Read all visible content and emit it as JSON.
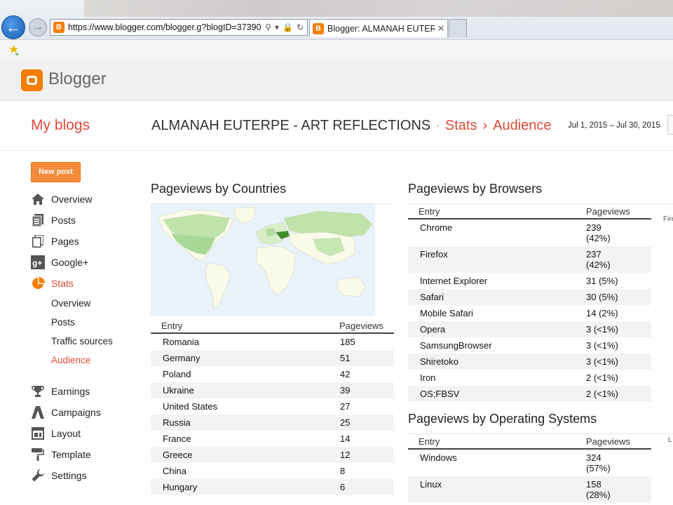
{
  "browser": {
    "url": "https://www.blogger.com/blogger.g?blogID=37390",
    "tab_title": "Blogger: ALMANAH EUTER...",
    "favicon": "B"
  },
  "header": {
    "brand": "Blogger",
    "brand_color": "#f57d00"
  },
  "topbar": {
    "my_blogs": "My blogs",
    "blog_name": "ALMANAH EUTERPE - ART REFLECTIONS",
    "sep": "·",
    "crumb_stats": "Stats",
    "crumb_arrow": "›",
    "crumb_audience": "Audience",
    "date_range": "Jul 1, 2015 – Jul 30, 2015"
  },
  "sidebar": {
    "new_post": "New post",
    "items": [
      {
        "label": "Overview"
      },
      {
        "label": "Posts"
      },
      {
        "label": "Pages"
      },
      {
        "label": "Google+"
      },
      {
        "label": "Stats"
      }
    ],
    "stats_sub": [
      {
        "label": "Overview"
      },
      {
        "label": "Posts"
      },
      {
        "label": "Traffic sources"
      },
      {
        "label": "Audience"
      }
    ],
    "items2": [
      {
        "label": "Earnings"
      },
      {
        "label": "Campaigns"
      },
      {
        "label": "Layout"
      },
      {
        "label": "Template"
      },
      {
        "label": "Settings"
      }
    ]
  },
  "countries": {
    "title": "Pageviews by Countries",
    "col_entry": "Entry",
    "col_pageviews": "Pageviews",
    "rows": [
      {
        "entry": "Romania",
        "pv": "185"
      },
      {
        "entry": "Germany",
        "pv": "51"
      },
      {
        "entry": "Poland",
        "pv": "42"
      },
      {
        "entry": "Ukraine",
        "pv": "39"
      },
      {
        "entry": "United States",
        "pv": "27"
      },
      {
        "entry": "Russia",
        "pv": "25"
      },
      {
        "entry": "France",
        "pv": "14"
      },
      {
        "entry": "Greece",
        "pv": "12"
      },
      {
        "entry": "China",
        "pv": "8"
      },
      {
        "entry": "Hungary",
        "pv": "6"
      }
    ]
  },
  "browsers": {
    "title": "Pageviews by Browsers",
    "col_entry": "Entry",
    "col_pageviews": "Pageviews",
    "side_label": "Fire",
    "rows": [
      {
        "entry": "Chrome",
        "pv": "239\n(42%)"
      },
      {
        "entry": "Firefox",
        "pv": "237\n(42%)"
      },
      {
        "entry": "Internet Explorer",
        "pv": "31 (5%)"
      },
      {
        "entry": "Safari",
        "pv": "30 (5%)"
      },
      {
        "entry": "Mobile Safari",
        "pv": "14 (2%)"
      },
      {
        "entry": "Opera",
        "pv": "3 (<1%)"
      },
      {
        "entry": "SamsungBrowser",
        "pv": "3 (<1%)"
      },
      {
        "entry": "Shiretoko",
        "pv": "3 (<1%)"
      },
      {
        "entry": "Iron",
        "pv": "2 (<1%)"
      },
      {
        "entry": "OS;FBSV",
        "pv": "2 (<1%)"
      }
    ]
  },
  "os": {
    "title": "Pageviews by Operating Systems",
    "col_entry": "Entry",
    "col_pageviews": "Pageviews",
    "side_label": "L",
    "rows": [
      {
        "entry": "Windows",
        "pv": "324\n(57%)"
      },
      {
        "entry": "Linux",
        "pv": "158\n(28%)"
      }
    ]
  }
}
